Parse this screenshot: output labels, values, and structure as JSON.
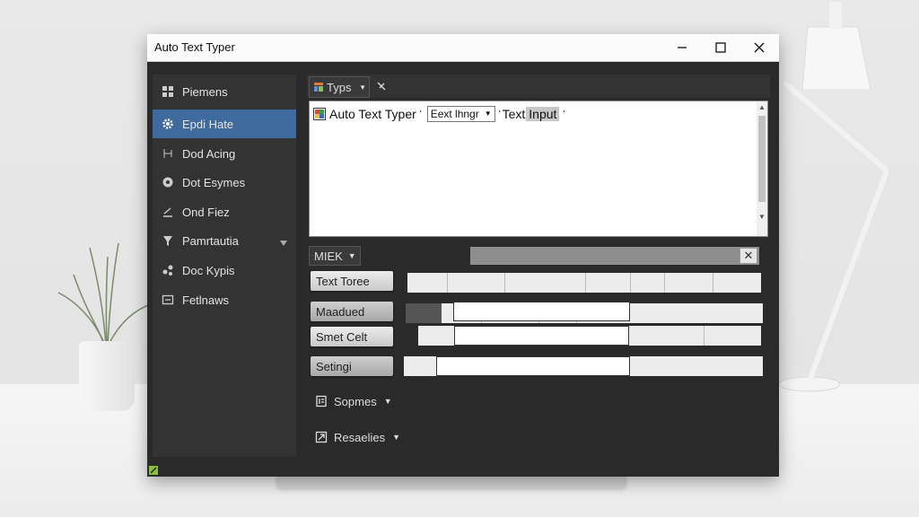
{
  "window": {
    "title": "Auto Text Typer",
    "controls": {
      "minimize": "minimize-icon",
      "maximize": "maximize-icon",
      "close": "close-icon"
    }
  },
  "sidebar": {
    "items": [
      {
        "label": "Piemens",
        "icon": "grid-icon",
        "active": false
      },
      {
        "label": "Epdi Hate",
        "icon": "gear-icon",
        "active": true
      },
      {
        "label": "Dod Acing",
        "icon": "network-icon",
        "active": false
      },
      {
        "label": "Dot Esymes",
        "icon": "circle-icon",
        "active": false
      },
      {
        "label": "Ond Fiez",
        "icon": "pen-line-icon",
        "active": false
      },
      {
        "label": "Pamrtautia",
        "icon": "funnel-icon",
        "active": false,
        "has_dropdown": true
      },
      {
        "label": "Doc Kypis",
        "icon": "share-nodes-icon",
        "active": false
      },
      {
        "label": "Fetlnaws",
        "icon": "window-icon",
        "active": false
      }
    ],
    "accent_color": "#3f6a9e"
  },
  "toolbar": {
    "types_tab": "Typs",
    "pin_icon": "pin-icon"
  },
  "editor": {
    "app_name": "Auto Text Typer",
    "select_value": "Eext lhngr",
    "text_label": "Text",
    "input_chip": "Input"
  },
  "panel": {
    "header": "MIEK",
    "close_symbol": "✕",
    "rows": [
      {
        "button": "Text Toree"
      },
      {
        "button": "Maadued"
      },
      {
        "button": "Smet Celt"
      },
      {
        "button": "Setingi"
      }
    ],
    "sections": [
      {
        "label": "Sopmes",
        "icon": "document-icon"
      },
      {
        "label": "Resaelies",
        "icon": "arrow-box-icon"
      }
    ]
  }
}
